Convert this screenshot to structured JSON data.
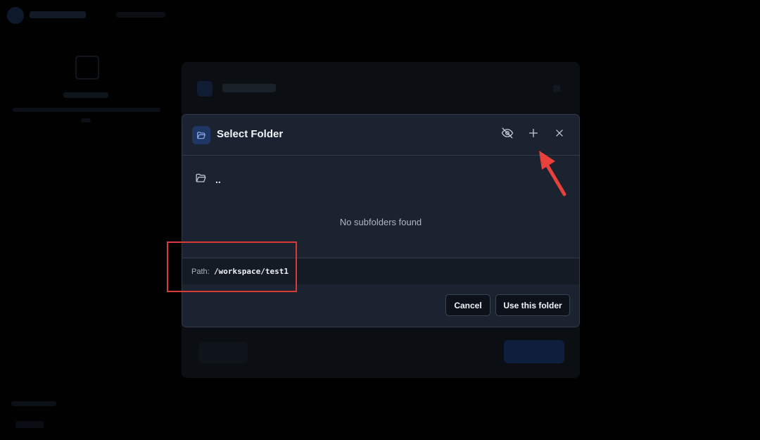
{
  "dialog": {
    "title": "Select Folder",
    "header_icon": "folder-open-icon",
    "header_actions": [
      {
        "name": "toggle-hidden-button",
        "icon": "eye-off-icon"
      },
      {
        "name": "new-folder-button",
        "icon": "plus-icon"
      },
      {
        "name": "close-button",
        "icon": "close-icon"
      }
    ],
    "parent_folder": {
      "icon": "folder-open-icon",
      "label": ".."
    },
    "empty_message": "No subfolders found",
    "path": {
      "label": "Path:",
      "value": "/workspace/test1"
    },
    "buttons": {
      "cancel": "Cancel",
      "confirm": "Use this folder"
    }
  },
  "annotations": {
    "highlight_color": "#d93a36",
    "arrow_color": "#e8403a"
  },
  "colors": {
    "background": "#010101",
    "dialog_bg": "#1b2330",
    "border": "#313a48",
    "accent": "#1f3665",
    "text": "#f1f4f8",
    "muted_text": "#aeb6c2"
  }
}
